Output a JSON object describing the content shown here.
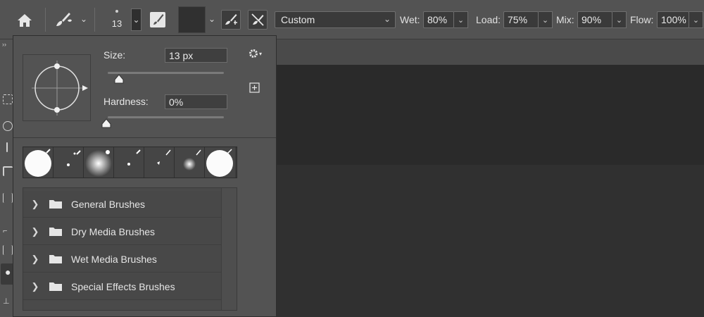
{
  "options_bar": {
    "brush_size_preview": "13",
    "blend_mode": "Custom",
    "wet_label": "Wet:",
    "wet_value": "80%",
    "load_label": "Load:",
    "load_value": "75%",
    "mix_label": "Mix:",
    "mix_value": "90%",
    "flow_label": "Flow:",
    "flow_value": "100%"
  },
  "brush_picker": {
    "size_label": "Size:",
    "size_value": "13 px",
    "size_slider": 0.05,
    "hardness_label": "Hardness:",
    "hardness_value": "0%",
    "hardness_slider": 0.0,
    "folders": [
      {
        "label": "General Brushes"
      },
      {
        "label": "Dry Media Brushes"
      },
      {
        "label": "Wet Media Brushes"
      },
      {
        "label": "Special Effects Brushes"
      }
    ]
  },
  "colors": {
    "panel": "#535353",
    "canvas": "#282828",
    "field": "#3a3a3a"
  }
}
